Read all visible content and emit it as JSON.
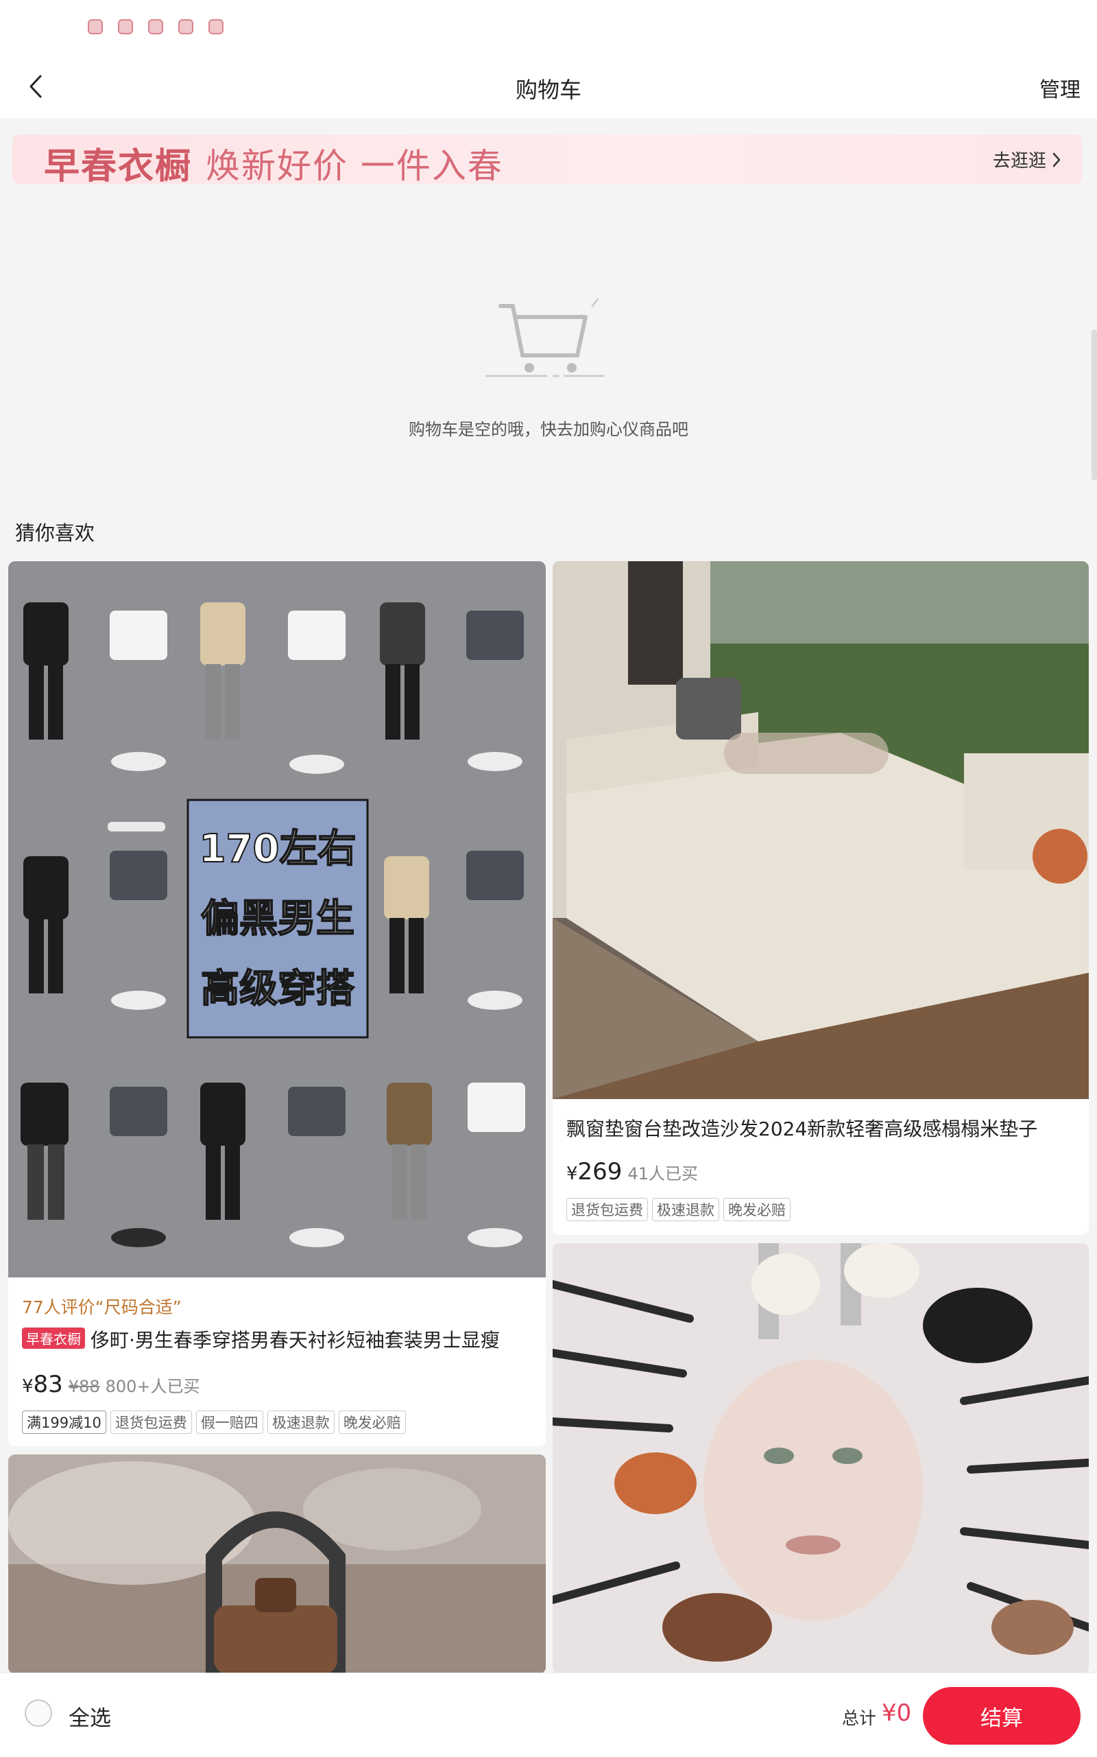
{
  "nav": {
    "title": "购物车",
    "manage_label": "管理"
  },
  "promo_banner": {
    "title": "早春衣橱",
    "slogan": "焕新好价 一件入春",
    "link_label": "去逛逛"
  },
  "empty_cart": {
    "message": "购物车是空的哦，快去加购心仪商品吧"
  },
  "recommend": {
    "section_title": "猜你喜欢",
    "products": [
      {
        "image_text": [
          "170左右",
          "偏黑男生",
          "高级穿搭"
        ],
        "review": "77人评价“尺码合适”",
        "promo_tag": "早春衣橱",
        "title": "侈町·男生春季穿搭男春天衬衫短袖套装男士显瘦",
        "currency": "¥",
        "price": "83",
        "original_price": "¥88",
        "buyers": "800+人已买",
        "tags": [
          "满199减10",
          "退货包运费",
          "假一赔四",
          "极速退款",
          "晚发必赔"
        ]
      },
      {
        "title": "飘窗垫窗台垫改造沙发2024新款轻奢高级感榻榻米垫子",
        "currency": "¥",
        "price": "269",
        "buyers": "41人已买",
        "tags": [
          "退货包运费",
          "极速退款",
          "晚发必赔"
        ]
      },
      {
        "image_desc": "teapot"
      },
      {
        "image_desc": "makeup brushes"
      }
    ]
  },
  "bottom_bar": {
    "select_all_label": "全选",
    "total_label": "总计",
    "total_amount": "¥0",
    "checkout_label": "结算"
  },
  "colors": {
    "accent": "#f0213c",
    "promo_pink": "#fde3e5",
    "review_orange": "#c0762d"
  }
}
